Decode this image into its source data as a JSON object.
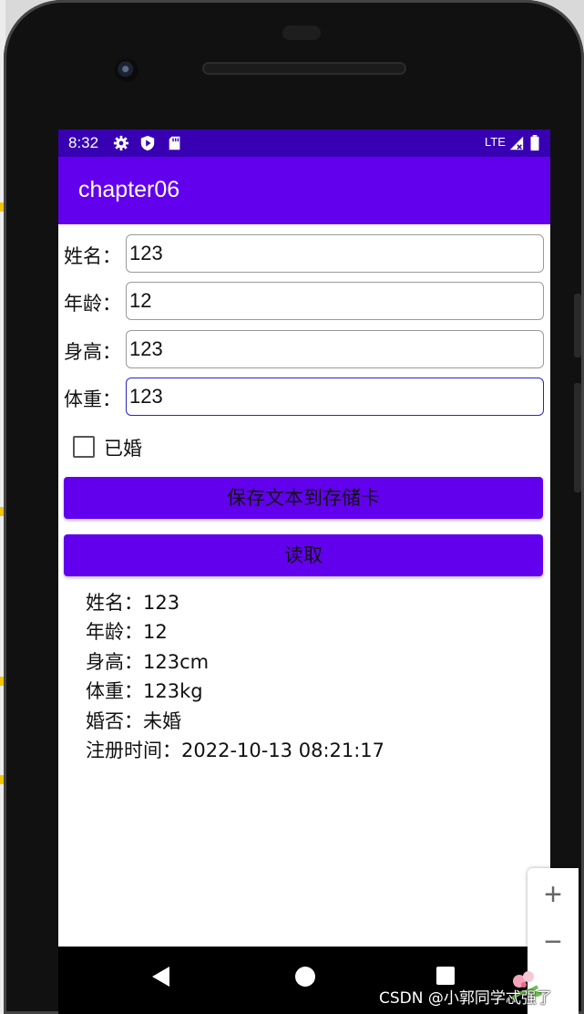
{
  "status_bar": {
    "time": "8:32",
    "network": "LTE"
  },
  "app_bar": {
    "title": "chapter06"
  },
  "form": {
    "name": {
      "label": "姓名：",
      "value": "123"
    },
    "age": {
      "label": "年龄：",
      "value": "12"
    },
    "height": {
      "label": "身高：",
      "value": "123"
    },
    "weight": {
      "label": "体重：",
      "value": "123"
    },
    "married": {
      "label": "已婚",
      "checked": false
    }
  },
  "buttons": {
    "save": "保存文本到存储卡",
    "read": "读取"
  },
  "output": [
    "姓名：123",
    "年龄：12",
    "身高：123cm",
    "体重：123kg",
    "婚否：未婚",
    "注册时间：2022-10-13 08:21:17"
  ],
  "zoom_controls": {
    "zoom_in": "+",
    "zoom_out": "−"
  },
  "watermark": "CSDN @小郭同学忒强了",
  "colors": {
    "status_bar": "#3700b3",
    "primary": "#6200ee",
    "focused_border": "#2a24c8"
  }
}
